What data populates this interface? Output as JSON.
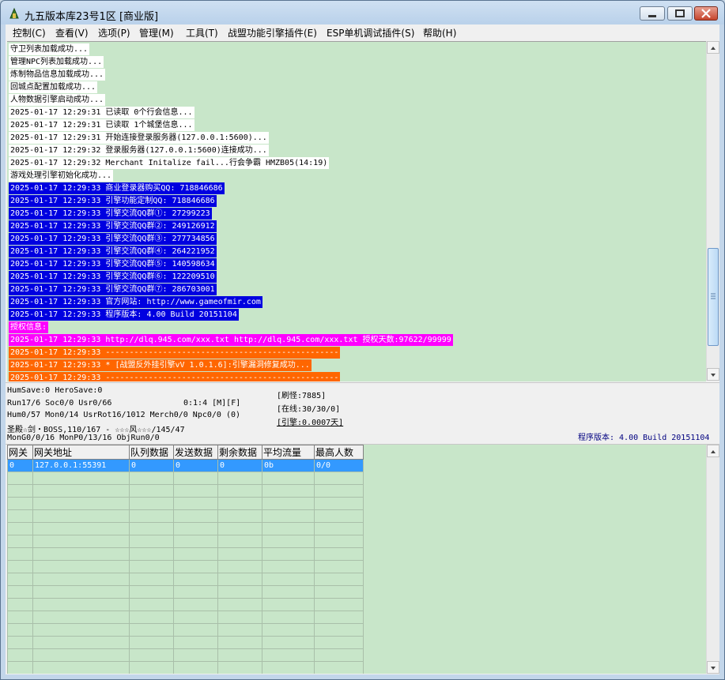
{
  "window": {
    "title": "九五版本库23号1区 [商业版]"
  },
  "menu": [
    {
      "label": "控制(C)"
    },
    {
      "label": "查看(V)"
    },
    {
      "label": "选项(P)"
    },
    {
      "label": "管理(M)"
    },
    {
      "label": "工具(T)"
    },
    {
      "label": "战盟功能引擎插件(E)"
    },
    {
      "label": "ESP单机调试插件(S)"
    },
    {
      "label": "帮助(H)"
    }
  ],
  "colors": {
    "log_background": "#c8e6c9",
    "highlight_blue": "#0000e0",
    "highlight_magenta": "#ff00ff",
    "highlight_orange": "#ff6600",
    "selection": "#3399ff"
  },
  "log": [
    {
      "text": "守卫列表加载成功...",
      "bg": "#ffffff",
      "fg": "#000000"
    },
    {
      "text": "管理NPC列表加载成功...",
      "bg": "#ffffff",
      "fg": "#000000"
    },
    {
      "text": "炼制物品信息加载成功...",
      "bg": "#ffffff",
      "fg": "#000000"
    },
    {
      "text": "回城点配置加载成功...",
      "bg": "#ffffff",
      "fg": "#000000"
    },
    {
      "text": "人物数据引擎启动成功...",
      "bg": "#ffffff",
      "fg": "#000000"
    },
    {
      "text": "2025-01-17 12:29:31 已读取 0个行会信息...",
      "bg": "#ffffff",
      "fg": "#000000"
    },
    {
      "text": "2025-01-17 12:29:31 已读取 1个城堡信息...",
      "bg": "#ffffff",
      "fg": "#000000"
    },
    {
      "text": "2025-01-17 12:29:31 开始连接登录服务器(127.0.0.1:5600)...",
      "bg": "#ffffff",
      "fg": "#000000"
    },
    {
      "text": "2025-01-17 12:29:32 登录服务器(127.0.0.1:5600)连接成功...",
      "bg": "#ffffff",
      "fg": "#000000"
    },
    {
      "text": "2025-01-17 12:29:32 Merchant Initalize fail...行会争霸 HMZB05(14:19)",
      "bg": "#ffffff",
      "fg": "#000000"
    },
    {
      "text": "游戏处理引擎初始化成功...",
      "bg": "#ffffff",
      "fg": "#000000"
    },
    {
      "text": "2025-01-17 12:29:33 商业登录器购买QQ: 718846686",
      "bg": "#0000e0",
      "fg": "#ffffff"
    },
    {
      "text": "2025-01-17 12:29:33 引擎功能定制QQ: 718846686",
      "bg": "#0000e0",
      "fg": "#ffffff"
    },
    {
      "text": "2025-01-17 12:29:33 引擎交流QQ群①: 27299223",
      "bg": "#0000e0",
      "fg": "#ffffff"
    },
    {
      "text": "2025-01-17 12:29:33 引擎交流QQ群②: 249126912",
      "bg": "#0000e0",
      "fg": "#ffffff"
    },
    {
      "text": "2025-01-17 12:29:33 引擎交流QQ群③: 277734856",
      "bg": "#0000e0",
      "fg": "#ffffff"
    },
    {
      "text": "2025-01-17 12:29:33 引擎交流QQ群④: 264221952",
      "bg": "#0000e0",
      "fg": "#ffffff"
    },
    {
      "text": "2025-01-17 12:29:33 引擎交流QQ群⑤: 140598634",
      "bg": "#0000e0",
      "fg": "#ffffff"
    },
    {
      "text": "2025-01-17 12:29:33 引擎交流QQ群⑥: 122209510",
      "bg": "#0000e0",
      "fg": "#ffffff"
    },
    {
      "text": "2025-01-17 12:29:33 引擎交流QQ群⑦: 286703001",
      "bg": "#0000e0",
      "fg": "#ffffff"
    },
    {
      "text": "2025-01-17 12:29:33 官方网站: http://www.gameofmir.com",
      "bg": "#0000e0",
      "fg": "#ffffff"
    },
    {
      "text": "2025-01-17 12:29:33 程序版本: 4.00 Build 20151104",
      "bg": "#0000e0",
      "fg": "#ffffff"
    },
    {
      "text": "授权信息:",
      "bg": "#ff00ff",
      "fg": "#ffffff"
    },
    {
      "text": "2025-01-17 12:29:33 http://dlq.945.com/xxx.txt http://dlq.945.com/xxx.txt 授权天数:97622/99999",
      "bg": "#ff00ff",
      "fg": "#ffffff"
    },
    {
      "text": "2025-01-17 12:29:33 -------------------------------------------------",
      "bg": "#ff6600",
      "fg": "#ffffff"
    },
    {
      "text": "2025-01-17 12:29:33 * [战盟反外挂引擎vV 1.0.1.6]:引擎漏洞修复成功...",
      "bg": "#ff6600",
      "fg": "#ffffff"
    },
    {
      "text": "2025-01-17 12:29:33 -------------------------------------------------",
      "bg": "#ff6600",
      "fg": "#ffffff"
    }
  ],
  "status": {
    "line1": "HumSave:0 HeroSave:0",
    "line2a": "Run17/6 Soc0/0 Usr0/66",
    "line2b": "0:1:4 [M][F]",
    "line3": "Hum0/57 Mon0/14 UsrRot16/1012 Merch0/0 Npc0/0 (0)",
    "line4": "圣殿☆剑・BOSS,110/167 - ☆☆☆风☆☆☆/145/47",
    "line5": "MonG0/0/16 MonP0/13/16 ObjRun0/0",
    "refresh": "[刷怪:7885]",
    "online": "[在线:30/30/0]",
    "engine": "[引擎:0.0007天]",
    "version": "程序版本: 4.00 Build 20151104"
  },
  "gateway_table": {
    "columns": [
      "网关",
      "网关地址",
      "队列数据",
      "发送数据",
      "剩余数据",
      "平均流量",
      "最高人数"
    ],
    "rows": [
      [
        "0",
        "127.0.0.1:55391",
        "0",
        "0",
        "0",
        "0b",
        "0/0"
      ]
    ],
    "empty_rows": 16
  }
}
